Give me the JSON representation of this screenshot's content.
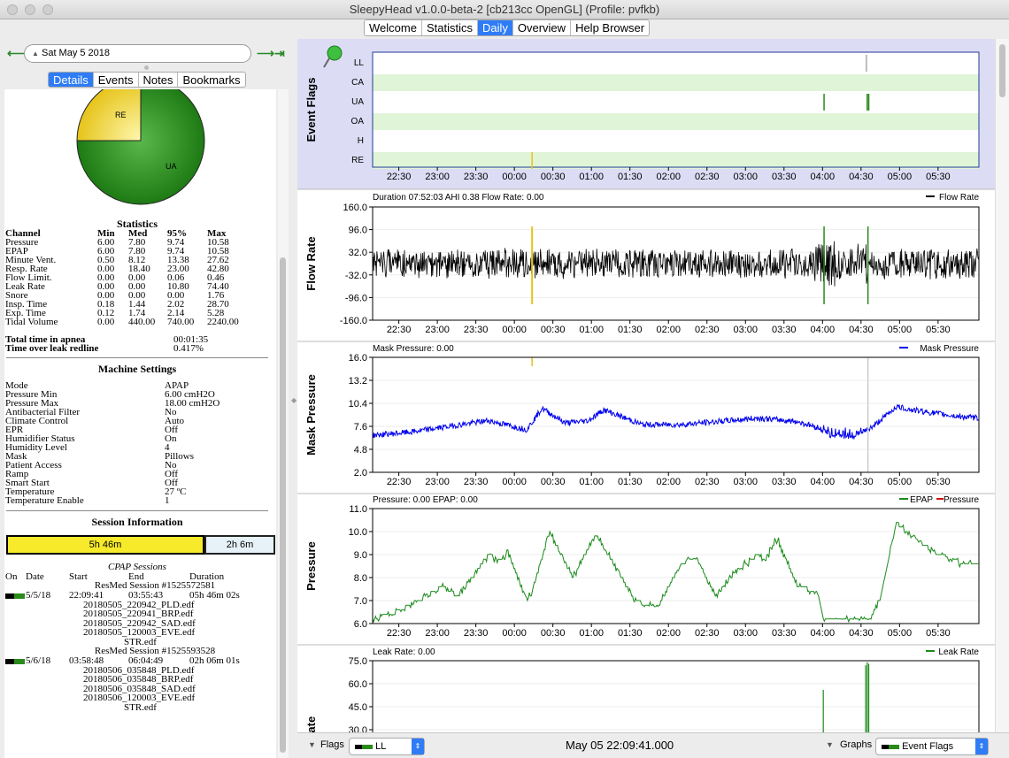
{
  "window": {
    "title": "SleepyHead v1.0.0-beta-2 [cb213cc OpenGL] (Profile: pvfkb)"
  },
  "tabs": [
    "Welcome",
    "Statistics",
    "Daily",
    "Overview",
    "Help Browser"
  ],
  "date_nav": {
    "date": "Sat May 5 2018",
    "prev_icon": "arrow-left-icon",
    "next_icon": "arrow-right-icon",
    "last_icon": "arrow-right-end-icon"
  },
  "detail_tabs": [
    "Details",
    "Events",
    "Notes",
    "Bookmarks"
  ],
  "pie": {
    "labels": [
      "RE",
      "UA"
    ],
    "slices": [
      {
        "label": "RE",
        "fraction": 0.25,
        "color": "#e8c820"
      },
      {
        "label": "UA",
        "fraction": 0.75,
        "color": "#2a8a1a"
      }
    ]
  },
  "statistics": {
    "title": "Statistics",
    "headers": [
      "Channel",
      "Min",
      "Med",
      "95%",
      "Max"
    ],
    "rows": [
      [
        "Pressure",
        "6.00",
        "7.80",
        "9.74",
        "10.58"
      ],
      [
        "EPAP",
        "6.00",
        "7.80",
        "9.74",
        "10.58"
      ],
      [
        "Minute Vent.",
        "0.50",
        "8.12",
        "13.38",
        "27.62"
      ],
      [
        "Resp. Rate",
        "0.00",
        "18.40",
        "23.00",
        "42.80"
      ],
      [
        "Flow Limit.",
        "0.00",
        "0.00",
        "0.06",
        "0.46"
      ],
      [
        "Leak Rate",
        "0.00",
        "0.00",
        "10.80",
        "74.40"
      ],
      [
        "Snore",
        "0.00",
        "0.00",
        "0.00",
        "1.76"
      ],
      [
        "Insp. Time",
        "0.18",
        "1.44",
        "2.02",
        "28.70"
      ],
      [
        "Exp. Time",
        "0.12",
        "1.74",
        "2.14",
        "5.28"
      ],
      [
        "Tidal Volume",
        "0.00",
        "440.00",
        "740.00",
        "2240.00"
      ]
    ],
    "summary": [
      [
        "Total time in apnea",
        "00:01:35"
      ],
      [
        "Time over leak redline",
        "0.417%"
      ]
    ]
  },
  "machine": {
    "title": "Machine Settings",
    "rows": [
      [
        "Mode",
        "APAP"
      ],
      [
        "Pressure Min",
        "6.00 cmH2O"
      ],
      [
        "Pressure Max",
        "18.00 cmH2O"
      ],
      [
        "Antibacterial Filter",
        "No"
      ],
      [
        "Climate Control",
        "Auto"
      ],
      [
        "EPR",
        "Off"
      ],
      [
        "Humidifier Status",
        "On"
      ],
      [
        "Humidity Level",
        "4"
      ],
      [
        "Mask",
        "Pillows"
      ],
      [
        "Patient Access",
        "No"
      ],
      [
        "Ramp",
        "Off"
      ],
      [
        "Smart Start",
        "Off"
      ],
      [
        "Temperature",
        "27 ºC"
      ],
      [
        "Temperature Enable",
        "1"
      ]
    ]
  },
  "session_info": {
    "title": "Session Information",
    "bar_labels": [
      "5h 46m",
      "2h 6m"
    ],
    "bar_fractions": [
      0.733,
      0.267
    ],
    "cpap_title": "CPAP Sessions",
    "headers": [
      "On",
      "Date",
      "Start",
      "End",
      "Duration"
    ],
    "sessions": [
      {
        "name": "ResMed Session #1525572581",
        "date": "5/5/18",
        "start": "22:09:41",
        "end": "03:55:43",
        "duration": "05h 46m 02s",
        "files": [
          "20180505_220942_PLD.edf",
          "20180505_220941_BRP.edf",
          "20180505_220942_SAD.edf",
          "20180505_120003_EVE.edf",
          "STR.edf"
        ]
      },
      {
        "name": "ResMed Session #1525593528",
        "date": "5/6/18",
        "start": "03:58:48",
        "end": "06:04:49",
        "duration": "02h 06m 01s",
        "files": [
          "20180506_035848_PLD.edf",
          "20180506_035848_BRP.edf",
          "20180506_035848_SAD.edf",
          "20180506_120003_EVE.edf",
          "STR.edf"
        ]
      }
    ]
  },
  "time_ticks": [
    "22:30",
    "23:00",
    "23:30",
    "00:00",
    "00:30",
    "01:00",
    "01:30",
    "02:00",
    "02:30",
    "03:00",
    "03:30",
    "04:00",
    "04:30",
    "05:00",
    "05:30"
  ],
  "time_ticks_hours": [
    0.34,
    0.84,
    1.34,
    1.84,
    2.34,
    2.84,
    3.34,
    3.84,
    4.34,
    4.84,
    5.34,
    5.84,
    6.34,
    6.84,
    7.34
  ],
  "graphs": {
    "event_flags": {
      "ylabel": "Event Flags",
      "rows": [
        "LL",
        "CA",
        "UA",
        "OA",
        "H",
        "RE"
      ],
      "events": [
        {
          "row": "LL",
          "hours": 6.41
        },
        {
          "row": "UA",
          "hours": 5.86
        },
        {
          "row": "UA",
          "hours": 6.42
        },
        {
          "row": "UA",
          "hours": 6.44
        },
        {
          "row": "RE",
          "hours": 2.07
        }
      ]
    },
    "flow_rate": {
      "ylabel": "Flow Rate",
      "info": "Duration 07:52:03 AHI 0.38 Flow Rate: 0.00",
      "legend": "Flow Rate",
      "ticks": [
        "160.0",
        "96.0",
        "32.0",
        "-32.0",
        "-96.0",
        "-160.0"
      ],
      "ylim": [
        -160,
        160
      ]
    },
    "mask_pressure": {
      "ylabel": "Mask Pressure",
      "info": "Mask Pressure: 0.00",
      "legend": "Mask Pressure",
      "ticks": [
        "16.0",
        "13.2",
        "10.4",
        "7.6",
        "4.8",
        "2.0"
      ],
      "ylim": [
        2,
        16
      ]
    },
    "pressure": {
      "ylabel": "Pressure",
      "info": "Pressure: 0.00 EPAP: 0.00",
      "legend": [
        "EPAP",
        "Pressure"
      ],
      "ticks": [
        "11.0",
        "10.0",
        "9.0",
        "8.0",
        "7.0",
        "6.0"
      ],
      "ylim": [
        6,
        11
      ]
    },
    "leak_rate": {
      "ylabel": "Leak Rate",
      "info": "Leak Rate: 0.00",
      "legend": "Leak Rate",
      "ticks": [
        "75.0",
        "60.0",
        "45.0",
        "30.0"
      ],
      "ylim": [
        0,
        75
      ]
    }
  },
  "chart_data": [
    {
      "type": "line",
      "title": "Mask Pressure",
      "x_unit": "hours since 22:09:41",
      "ylim": [
        2,
        16
      ],
      "series": [
        {
          "name": "Mask Pressure",
          "x": [
            0,
            0.5,
            1,
            1.5,
            2,
            2.2,
            2.5,
            2.8,
            3,
            3.5,
            4,
            4.5,
            5,
            5.5,
            5.8,
            5.9,
            6.3,
            6.5,
            6.8,
            7,
            7.3,
            7.6,
            7.87
          ],
          "y": [
            6.5,
            6.9,
            7.6,
            8.3,
            7.2,
            9.8,
            8,
            8.3,
            9.6,
            7.8,
            7.8,
            8.2,
            8.6,
            8.2,
            7.4,
            6.8,
            6.6,
            7.6,
            10.0,
            9.6,
            9.2,
            8.8,
            8.6
          ]
        }
      ]
    },
    {
      "type": "line",
      "title": "Pressure",
      "x_unit": "hours since 22:09:41",
      "ylim": [
        6,
        11
      ],
      "series": [
        {
          "name": "EPAP",
          "x": [
            0,
            0.3,
            0.6,
            0.9,
            1.1,
            1.3,
            1.5,
            1.7,
            1.75,
            2.0,
            2.06,
            2.3,
            2.6,
            2.8,
            2.9,
            3.1,
            3.4,
            3.7,
            4.0,
            4.2,
            4.45,
            4.7,
            5.0,
            5.1,
            5.25,
            5.5,
            5.78,
            5.85,
            6.2,
            6.45,
            6.6,
            6.8,
            7.0,
            7.3,
            7.6,
            7.87
          ],
          "y": [
            6.2,
            6.5,
            7.0,
            7.6,
            7.2,
            8.0,
            9.0,
            8.7,
            9.2,
            7.0,
            7.3,
            10.0,
            8.0,
            9.3,
            9.8,
            8.8,
            7.0,
            6.7,
            8.6,
            8.9,
            7.2,
            8.2,
            9.0,
            8.8,
            9.7,
            7.7,
            7.3,
            6.2,
            6.1,
            6.1,
            7.2,
            10.4,
            9.8,
            9.1,
            8.7,
            8.5
          ]
        }
      ]
    },
    {
      "type": "line",
      "title": "Leak Rate",
      "x_unit": "hours since 22:09:41",
      "ylim": [
        0,
        75
      ],
      "series": [
        {
          "name": "Leak Rate",
          "x": [
            5.85,
            6.4,
            6.42,
            6.44
          ],
          "y": [
            56,
            72,
            74,
            73
          ]
        }
      ]
    }
  ],
  "bottom": {
    "flags_label": "Flags",
    "flags_value": "LL",
    "timestamp": "May 05 22:09:41.000",
    "graphs_label": "Graphs",
    "graphs_value": "Event Flags"
  }
}
